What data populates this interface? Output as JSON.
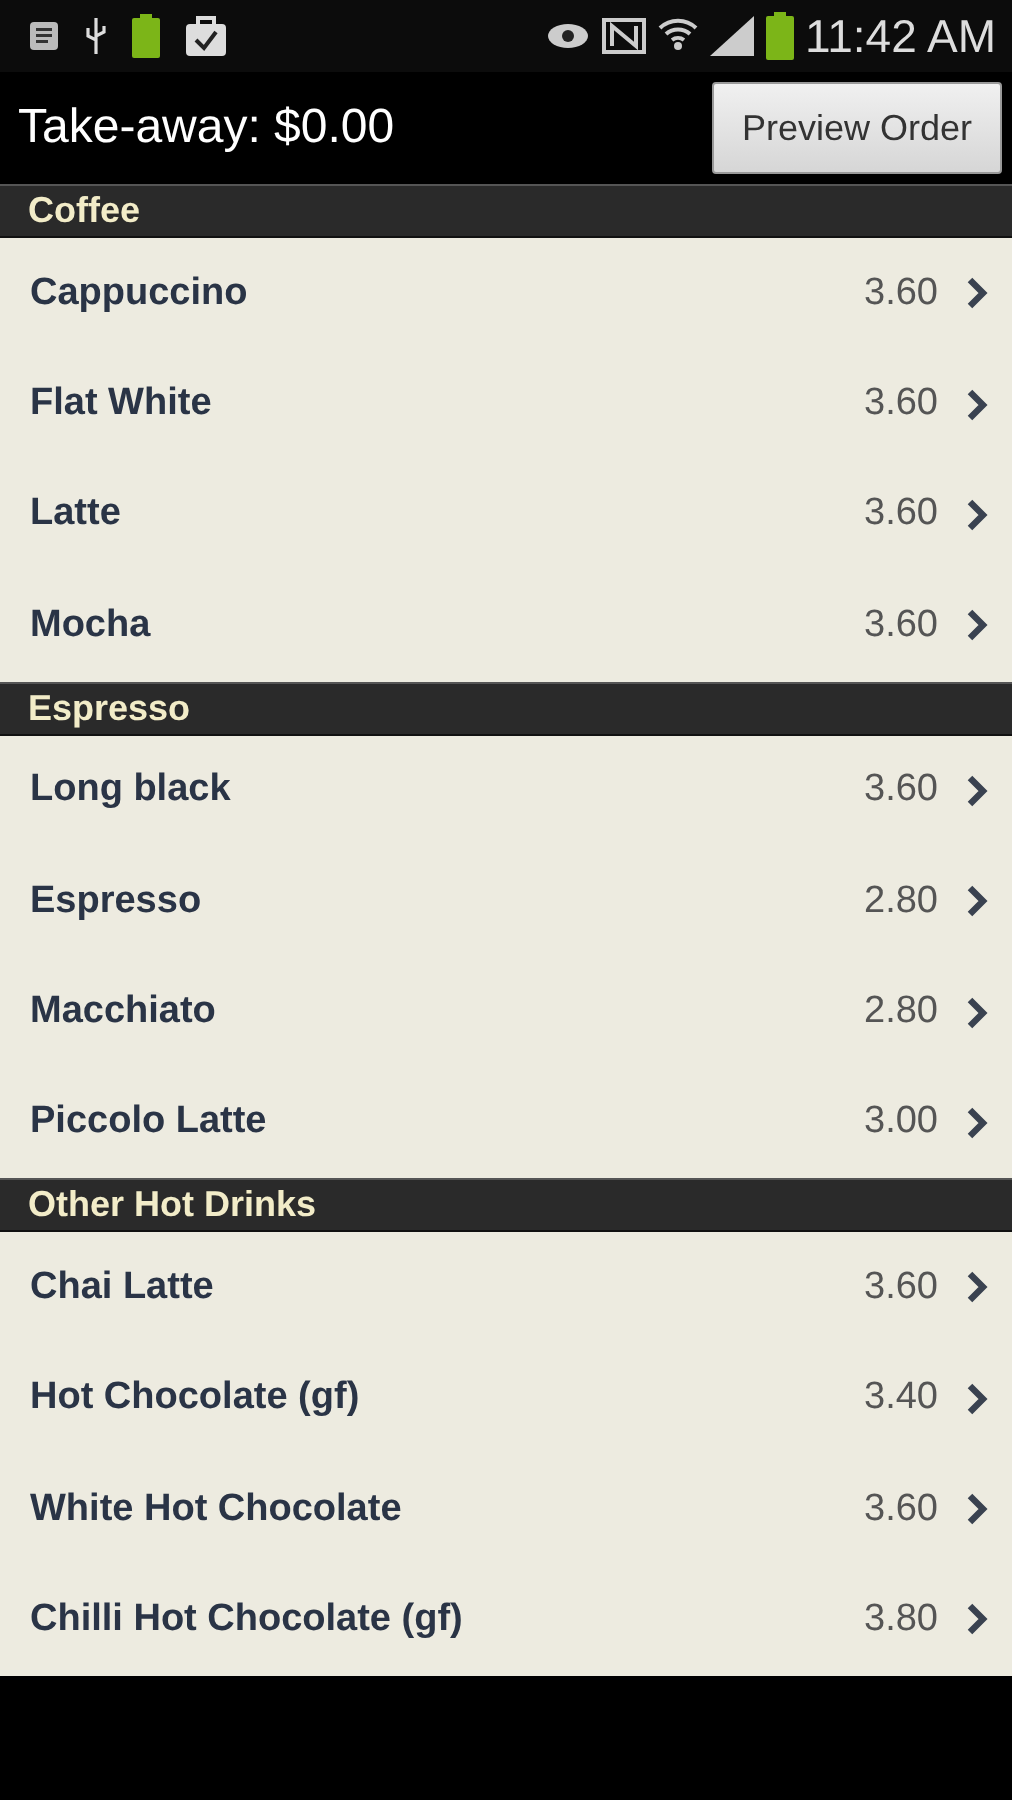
{
  "status_bar": {
    "time": "11:42 AM"
  },
  "toolbar": {
    "title": "Take-away: $0.00",
    "button": "Preview Order"
  },
  "sections": [
    {
      "title": "Coffee",
      "items": [
        {
          "name": "Cappuccino",
          "price": "3.60"
        },
        {
          "name": "Flat White",
          "price": "3.60"
        },
        {
          "name": "Latte",
          "price": "3.60"
        },
        {
          "name": "Mocha",
          "price": "3.60"
        }
      ]
    },
    {
      "title": "Espresso",
      "items": [
        {
          "name": "Long black",
          "price": "3.60"
        },
        {
          "name": "Espresso",
          "price": "2.80"
        },
        {
          "name": "Macchiato",
          "price": "2.80"
        },
        {
          "name": "Piccolo Latte",
          "price": "3.00"
        }
      ]
    },
    {
      "title": "Other Hot Drinks",
      "items": [
        {
          "name": "Chai Latte",
          "price": "3.60"
        },
        {
          "name": "Hot Chocolate (gf)",
          "price": "3.40"
        },
        {
          "name": "White Hot Chocolate",
          "price": "3.60"
        },
        {
          "name": "Chilli Hot Chocolate (gf)",
          "price": "3.80"
        }
      ]
    }
  ]
}
